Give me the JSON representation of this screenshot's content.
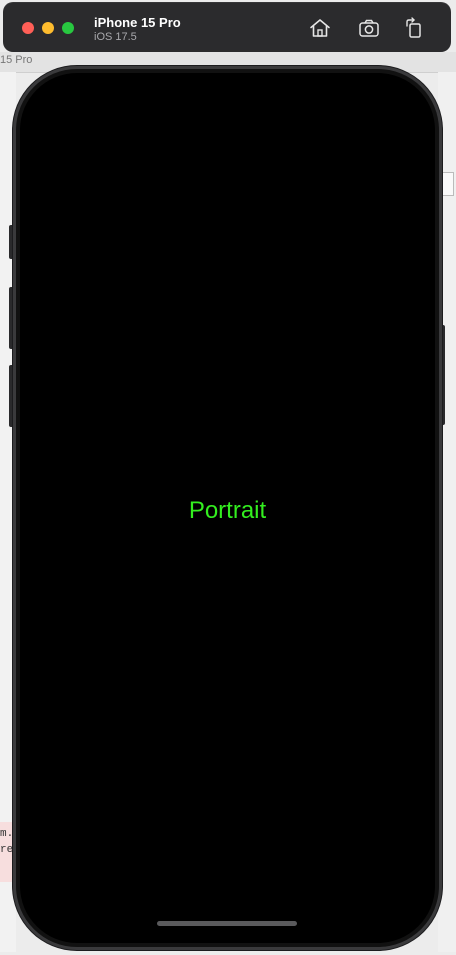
{
  "window": {
    "device_name": "iPhone 15 Pro",
    "os_version": "iOS 17.5"
  },
  "toolbar": {
    "home_icon": "home-icon",
    "screenshot_icon": "camera-icon",
    "rotate_icon": "rotate-icon"
  },
  "background": {
    "top_left_text": "15 Pro",
    "bottom_left_lines": [
      "m.",
      "re"
    ]
  },
  "screen": {
    "label": "Portrait",
    "label_color": "#33ee1f",
    "background": "#000000"
  },
  "colors": {
    "close": "#ff5f57",
    "minimize": "#febc2e",
    "maximize": "#28c840",
    "titlebar": "#2b2b2d"
  }
}
